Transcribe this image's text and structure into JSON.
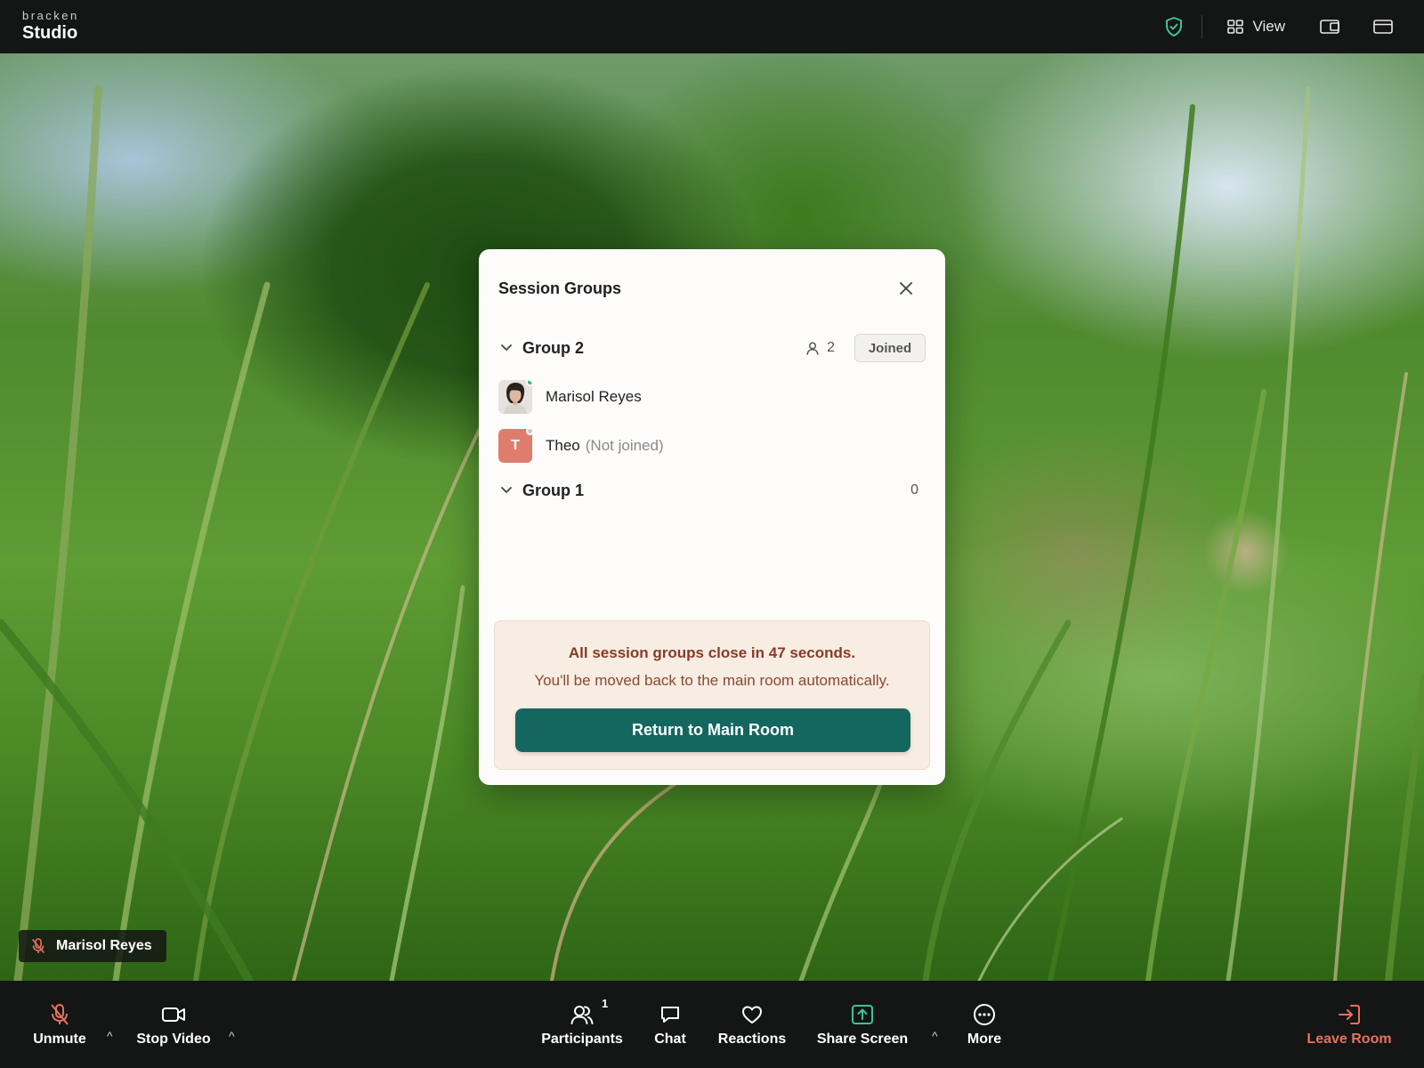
{
  "brand": {
    "small": "bracken",
    "name": "Studio"
  },
  "topbar": {
    "view_label": "View"
  },
  "stage": {
    "name_tag": "Marisol Reyes"
  },
  "modal": {
    "title": "Session Groups",
    "groups": [
      {
        "name": "Group 2",
        "count": "2",
        "status": "Joined",
        "members": [
          {
            "name": "Marisol Reyes",
            "note": "",
            "initial": "",
            "online": true
          },
          {
            "name": "Theo",
            "note": "(Not joined)",
            "initial": "T",
            "online": false
          }
        ]
      },
      {
        "name": "Group 1",
        "count": "0"
      }
    ],
    "notice": {
      "title": "All session groups close in 47 seconds.",
      "subtitle": "You'll be moved back to the main room automatically.",
      "button": "Return to Main Room"
    }
  },
  "toolbar": {
    "unmute": "Unmute",
    "stop_video": "Stop Video",
    "participants": "Participants",
    "participants_count": "1",
    "chat": "Chat",
    "reactions": "Reactions",
    "share_screen": "Share Screen",
    "more": "More",
    "leave": "Leave Room",
    "caret": "^"
  },
  "colors": {
    "accent": "#14675f",
    "danger": "#e8715f",
    "online": "#2fb28a",
    "share": "#3ec29b"
  }
}
